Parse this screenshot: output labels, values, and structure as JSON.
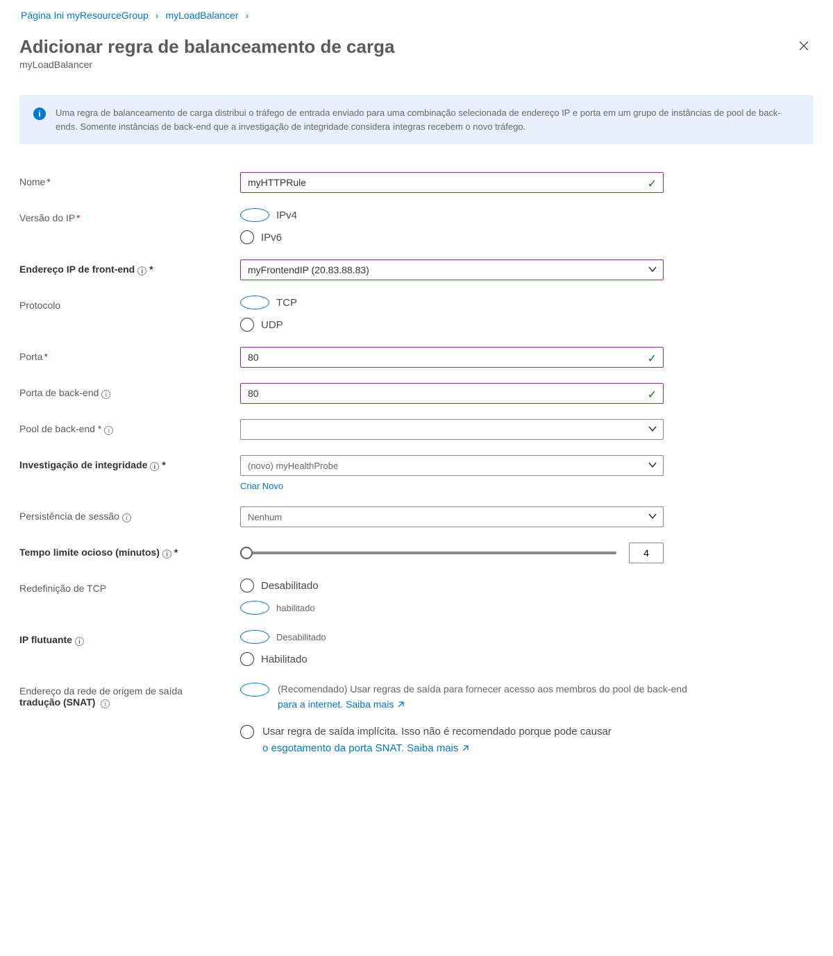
{
  "breadcrumb": {
    "home": "Página Ini",
    "rg": "myResourceGroup",
    "lb": "myLoadBalancer"
  },
  "header": {
    "title": "Adicionar regra de balanceamento de carga",
    "subtitle": "myLoadBalancer"
  },
  "info_text": "Uma regra de balanceamento de carga distribui o tráfego de entrada enviado para uma combinação selecionada de endereço IP e porta em um grupo de instâncias de pool de back-ends. Somente instâncias de back-end que a investigação de integridade considera íntegras recebem o novo tráfego.",
  "fields": {
    "name": {
      "label": "Nome",
      "value": "myHTTPRule"
    },
    "ip_version": {
      "label": "Versão do IP",
      "v4": "IPv4",
      "v6": "IPv6"
    },
    "frontend": {
      "label": "Endereço IP de front-end",
      "value": "myFrontendIP (20.83.88.83)"
    },
    "protocol": {
      "label": "Protocolo",
      "tcp": "TCP",
      "udp": "UDP"
    },
    "port": {
      "label": "Porta",
      "value": "80"
    },
    "backend_port": {
      "label": "Porta de back-end",
      "value": "80"
    },
    "backend_pool": {
      "label": "Pool de back-end",
      "value": ""
    },
    "probe": {
      "label": "Investigação de integridade",
      "value": "(novo) myHealthProbe",
      "create": "Criar Novo"
    },
    "session": {
      "label": "Persistência de sessão",
      "value": "Nenhum"
    },
    "idle": {
      "label": "Tempo limite ocioso (minutos)",
      "value": "4"
    },
    "tcp_reset": {
      "label": "Redefinição de TCP",
      "off": "Desabilitado",
      "on": "habilitado"
    },
    "floating": {
      "label": "IP flutuante",
      "off": "Desabilitado",
      "on": "Habilitado"
    },
    "snat": {
      "label_l1": "Endereço da rede de origem de saída",
      "label_l2": "tradução (SNAT)",
      "opt1_a": "(Recomendado) Usar regras de saída para fornecer acesso aos membros do pool de back-end",
      "opt1_b": "para a internet. Saiba mais",
      "opt2_a": "Usar regra de saída implícita. Isso não é recomendado porque pode causar",
      "opt2_b": " o esgotamento da porta SNAT. Saiba mais"
    }
  }
}
